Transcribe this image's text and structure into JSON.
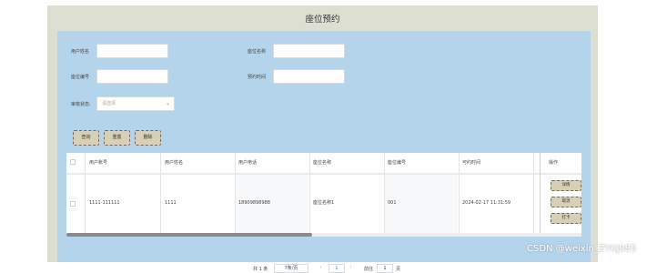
{
  "page": {
    "title": "座位预约"
  },
  "filters": {
    "username_label": "用户姓名",
    "seat_name_label": "座位名称",
    "seat_no_label": "座位编号",
    "time_label": "预约时间",
    "status_label": "审核状态:",
    "status_placeholder": "请选择"
  },
  "toolbar": {
    "query": "查询",
    "reset": "重置",
    "delete": "删除"
  },
  "table": {
    "headers": [
      "用户账号",
      "用户姓名",
      "用户电话",
      "座位名称",
      "座位编号",
      "可约时间",
      "操作"
    ],
    "row": [
      "1111-111111",
      "1111",
      "18909898988",
      "座位名称1",
      "001",
      "2024-02-17 11:31:59"
    ],
    "actions": {
      "detail": "详情",
      "cancel": "取消",
      "print": "打卡"
    }
  },
  "pagination": {
    "total": "共 1 条",
    "page_size": "7条/页",
    "current_page": "1",
    "goto_label": "前往",
    "goto_value": "1",
    "page_suffix": "页",
    "prev": "‹",
    "next": "›"
  },
  "watermark": "CSDN @weixin_ZYKJ985",
  "colors": {
    "panel": "#b3d4eb",
    "frame": "#dedfd3",
    "button": "#d8cfb7"
  }
}
